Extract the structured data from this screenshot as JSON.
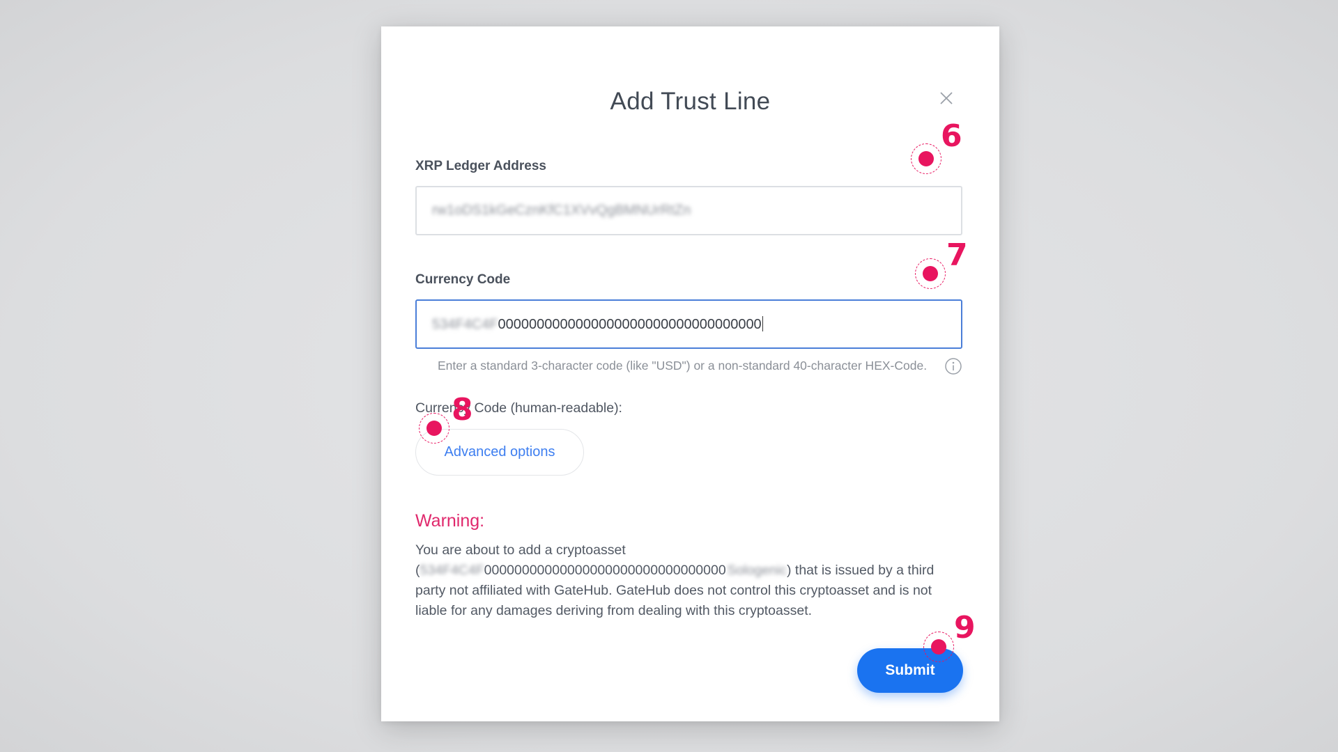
{
  "modal": {
    "title": "Add Trust Line",
    "close_icon": "close-icon"
  },
  "address_field": {
    "label": "XRP Ledger Address",
    "value": "rw1oDS1kGeCznKfC1XVvQgBMNUrRtZn"
  },
  "currency_field": {
    "label": "Currency Code",
    "value_prefix": "534F4C4F",
    "value_suffix": "0000000000000000000000000000000000",
    "hint": "Enter a standard 3-character code (like \"USD\") or a non-standard 40-character HEX-Code.",
    "info_icon": "info-icon"
  },
  "human_readable_label": "Currency Code (human-readable):",
  "advanced_options_label": "Advanced options",
  "warning": {
    "title": "Warning:",
    "line1": "You are about to add a cryptoasset",
    "paren_open": "(",
    "code_prefix": "534F4C4F",
    "code_suffix": "00000000000000000000000000000000",
    "issuer": "Sologenic",
    "line2_rest": ") that is issued by a third",
    "line3": "party not affiliated with GateHub. GateHub does not control this cryptoasset and is not",
    "line4": "liable for any damages deriving from dealing with this cryptoasset."
  },
  "submit_label": "Submit",
  "markers": {
    "m6": "6",
    "m7": "7",
    "m8": "8",
    "m9": "9"
  },
  "colors": {
    "accent": "#1a73f0",
    "warning": "#e0286c",
    "marker": "#e8155f",
    "focus_border": "#4a7ed8"
  }
}
